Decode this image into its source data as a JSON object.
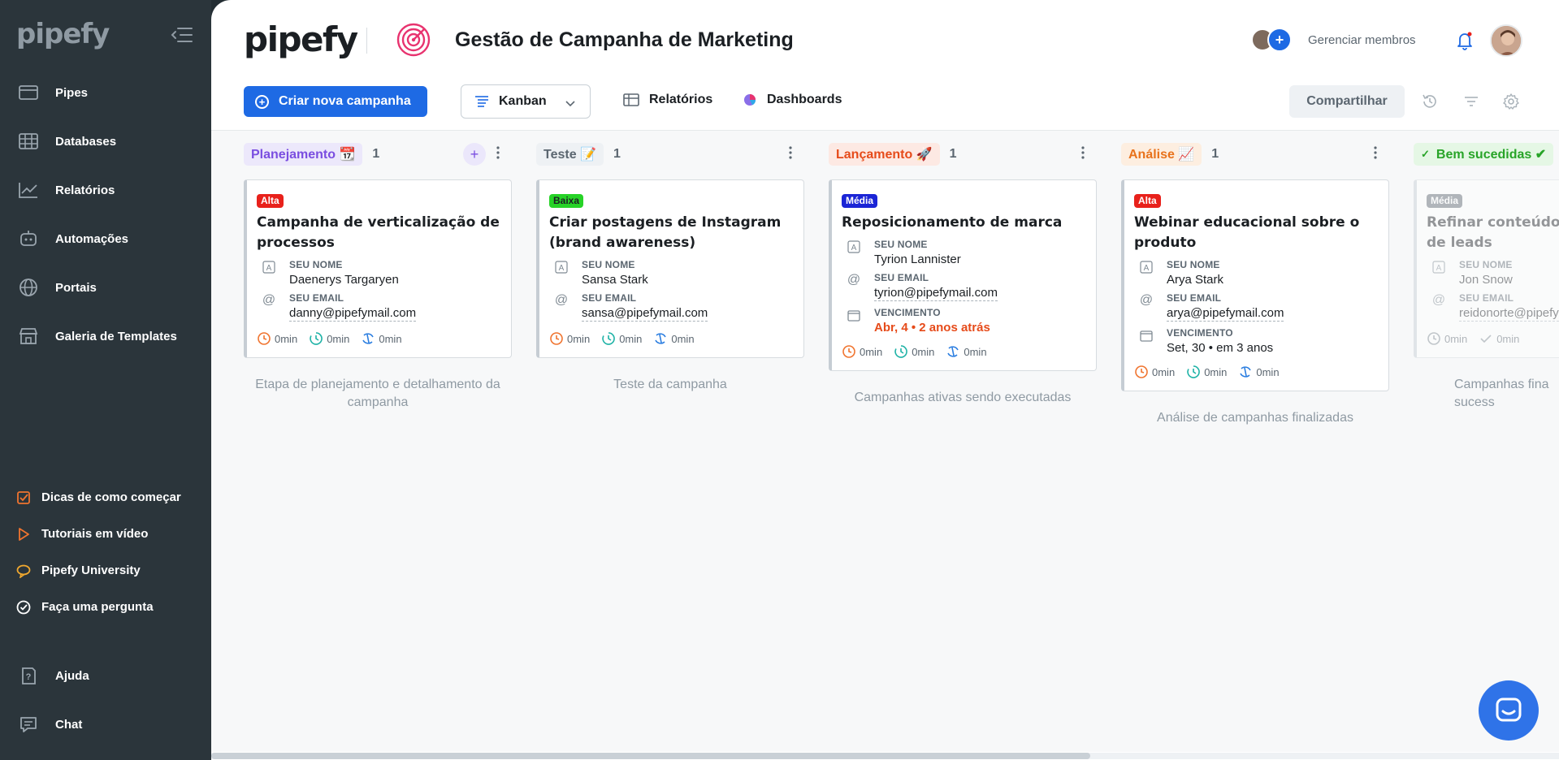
{
  "sidebar": {
    "logo": "pipefy",
    "nav": [
      {
        "label": "Pipes",
        "icon": "pipes-icon"
      },
      {
        "label": "Databases",
        "icon": "databases-icon"
      },
      {
        "label": "Relatórios",
        "icon": "reports-icon"
      },
      {
        "label": "Automações",
        "icon": "automations-icon"
      },
      {
        "label": "Portais",
        "icon": "portals-icon"
      },
      {
        "label": "Galeria de Templates",
        "icon": "templates-icon"
      }
    ],
    "resources": [
      {
        "label": "Dicas de como começar",
        "icon": "checklist-icon"
      },
      {
        "label": "Tutoriais em vídeo",
        "icon": "play-icon"
      },
      {
        "label": "Pipefy University",
        "icon": "chat-bubble-icon"
      },
      {
        "label": "Faça uma pergunta",
        "icon": "check-circle-icon"
      }
    ],
    "help": [
      {
        "label": "Ajuda",
        "icon": "help-icon"
      },
      {
        "label": "Chat",
        "icon": "chat-icon"
      }
    ]
  },
  "header": {
    "brand": "pipefy",
    "pipe_title": "Gestão de Campanha de Marketing",
    "manage_members": "Gerenciar membros"
  },
  "toolbar": {
    "create_label": "Criar nova campanha",
    "view_label": "Kanban",
    "reports_label": "Relatórios",
    "dashboards_label": "Dashboards",
    "share_label": "Compartilhar"
  },
  "phases": [
    {
      "name": "Planejamento 📆",
      "count": "1",
      "tag_bg": "#ece8fb",
      "tag_color": "#7a4ee0",
      "description": "Etapa de planejamento e detalhamento da campanha",
      "card": {
        "label": "Alta",
        "label_color": "#e8211b",
        "title": "Campanha de verticalização de processos",
        "name_key": "SEU NOME",
        "name": "Daenerys Targaryen",
        "email_key": "SEU EMAIL",
        "email": "danny@pipefymail.com",
        "timers": [
          "0min",
          "0min",
          "0min"
        ]
      }
    },
    {
      "name": "Teste 📝",
      "count": "1",
      "tag_bg": "#eef1f4",
      "tag_color": "#5b6670",
      "description": "Teste da campanha",
      "card": {
        "label": "Baixa",
        "label_color": "#27d327",
        "title": "Criar postagens de Instagram (brand awareness)",
        "name_key": "SEU NOME",
        "name": "Sansa Stark",
        "email_key": "SEU EMAIL",
        "email": "sansa@pipefymail.com",
        "timers": [
          "0min",
          "0min",
          "0min"
        ]
      }
    },
    {
      "name": "Lançamento 🚀",
      "count": "1",
      "tag_bg": "#fde9e3",
      "tag_color": "#e64b1a",
      "description": "Campanhas ativas sendo executadas",
      "card": {
        "label": "Média",
        "label_color": "#1b25d6",
        "title": "Reposicionamento de marca",
        "name_key": "SEU NOME",
        "name": "Tyrion Lannister",
        "email_key": "SEU EMAIL",
        "email": "tyrion@pipefymail.com",
        "due_key": "VENCIMENTO",
        "due": "Abr, 4 • 2 anos atrás",
        "timers": [
          "0min",
          "0min",
          "0min"
        ]
      }
    },
    {
      "name": "Análise 📈",
      "count": "1",
      "tag_bg": "#fdeee0",
      "tag_color": "#e8721b",
      "description": "Análise de campanhas finalizadas",
      "card": {
        "label": "Alta",
        "label_color": "#e8211b",
        "title": "Webinar educacional sobre o produto",
        "name_key": "SEU NOME",
        "name": "Arya Stark",
        "email_key": "SEU EMAIL",
        "email": "arya@pipefymail.com",
        "due_key": "VENCIMENTO",
        "due": "Set, 30 • em 3 anos",
        "timers": [
          "0min",
          "0min",
          "0min"
        ]
      }
    },
    {
      "name": "Bem sucedidas ✔",
      "count": "",
      "tag_bg": "#e5f7e5",
      "tag_color": "#28a428",
      "description": "Campanhas fina sucess",
      "card": {
        "label": "Média",
        "label_color": "#5b6670",
        "title": "Refinar conteúdo pa captação de leads",
        "name_key": "SEU NOME",
        "name": "Jon Snow",
        "email_key": "SEU EMAIL",
        "email": "reidonorte@pipefy",
        "timers": [
          "0min",
          "0min"
        ]
      }
    }
  ],
  "colors": {
    "accent": "#1e6ae4",
    "sidebar_bg": "#2b353b",
    "resource_icon": "#f0742f"
  }
}
